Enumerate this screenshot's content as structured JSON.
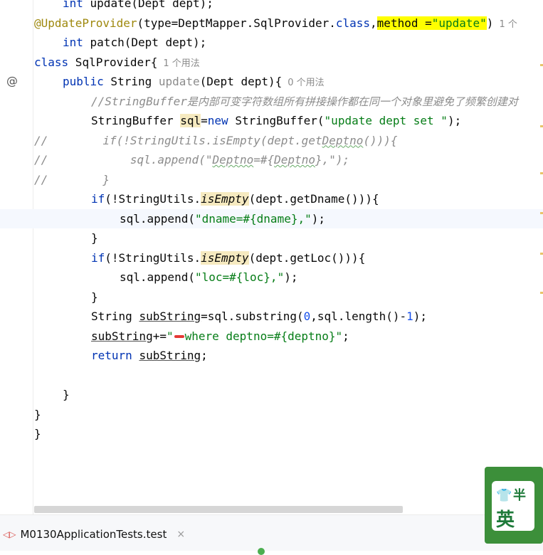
{
  "editor": {
    "l0": {
      "kw": "int",
      "rest": " update(Dept dept);"
    },
    "l1": {
      "ann": "@UpdateProvider",
      "p1": "(type=DeptMapper.SqlProvider.",
      "kw": "class",
      "p2": ",",
      "method_hl": "method =",
      "str": "\"update\"",
      "p3": ")",
      "inlay": "1 个"
    },
    "l2": {
      "kw": "int",
      "rest": " patch(Dept dept);"
    },
    "l3": {
      "kw": "class",
      "rest": " SqlProvider{",
      "inlay": "1 个用法"
    },
    "l4": {
      "kw": "public",
      "type": " String ",
      "method": "update",
      "rest": "(Dept dept){",
      "inlay": "0 个用法"
    },
    "l5": {
      "cmt_prefix": "//StringBuffer",
      "cmt_cjk": "是内部可变字符数组所有拼接操作都在同一个对象里避免了频繁创建对"
    },
    "l6": {
      "t1": "StringBuffer ",
      "var": "sql",
      "t2": "=",
      "kw": "new",
      "t3": " StringBuffer(",
      "str": "\"update dept set \"",
      "t4": ");"
    },
    "l7": {
      "slashes": "//",
      "cmt": "        if(!StringUtils.isEmpty(dept.get",
      "cmt_sq": "Deptno",
      "cmt_end": "())){"
    },
    "l8": {
      "slashes": "//",
      "cmt": "            sql.append(\"",
      "cmt_sq1": "Deptno",
      "cmt_mid": "=#{",
      "cmt_sq2": "Deptno",
      "cmt_end": "},\");"
    },
    "l9": {
      "slashes": "//",
      "cmt": "        }"
    },
    "l10": {
      "kw": "if",
      "t1": "(!StringUtils.",
      "method": "isEmpty",
      "t2": "(dept.getDname())){"
    },
    "l11": {
      "t1": "sql.append(",
      "str": "\"dname=#{dname},\"",
      "t2": ");"
    },
    "l12": {
      "t1": "}"
    },
    "l13": {
      "kw": "if",
      "t1": "(!StringUtils.",
      "method": "isEmpty",
      "t2": "(dept.getLoc())){"
    },
    "l14": {
      "t1": "sql.append(",
      "str": "\"loc=#{loc},\"",
      "t2": ");"
    },
    "l15": {
      "t1": "}"
    },
    "l16": {
      "t1": "String ",
      "var": "subString",
      "t2": "=sql.substring(",
      "n1": "0",
      "t3": ",sql.length()-",
      "n2": "1",
      "t4": ");"
    },
    "l17": {
      "var": "subString",
      "t1": "+=",
      "str_open": "\"",
      "str": "where deptno=#{deptno}\"",
      "t2": ";"
    },
    "l18": {
      "kw": "return",
      "t1": " ",
      "var": "subString",
      "t2": ";"
    },
    "l20": {
      "t1": "}"
    },
    "l21": {
      "t1": "}"
    },
    "l22": {
      "t1": "}"
    }
  },
  "gutter": {
    "at_icon": "@"
  },
  "tab": {
    "label": "M0130ApplicationTests.test",
    "close": "×"
  },
  "logo": {
    "char1": "半",
    "char2": "英"
  },
  "colors": {
    "keyword": "#0033b3",
    "string": "#067d17",
    "annotation": "#9e880d",
    "comment": "#8c8c8c"
  }
}
